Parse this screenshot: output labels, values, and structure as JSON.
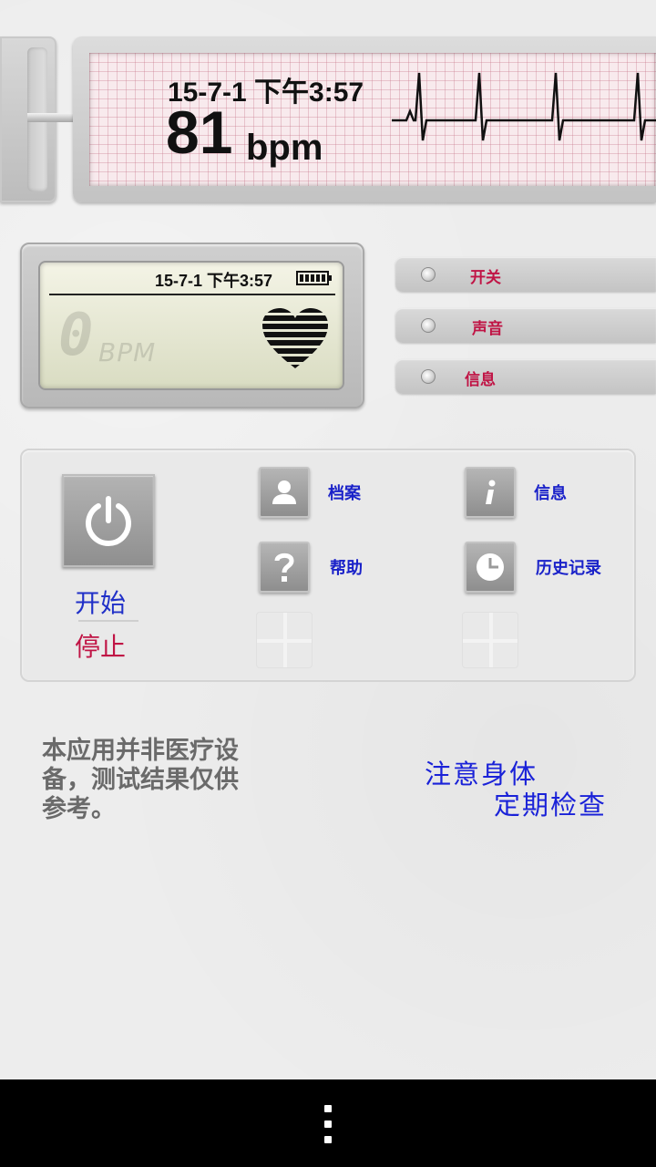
{
  "ecg_strip": {
    "date_time": "15-7-1 下午3:57",
    "bpm_value": "81",
    "bpm_unit": "bpm"
  },
  "lcd": {
    "date_time": "15-7-1 下午3:57",
    "bpm_digit": "0",
    "bpm_label": "BPM",
    "battery_level": 1.0
  },
  "toggles": [
    {
      "label": "开关"
    },
    {
      "label": "声音"
    },
    {
      "label": "信息"
    }
  ],
  "controls": {
    "start_label": "开始",
    "stop_label": "停止",
    "profile_label": "档案",
    "info_label": "信息",
    "help_label": "帮助",
    "history_label": "历史记录"
  },
  "disclaimer": "本应用并非医疗设备，测试结果仅供参考。",
  "health_tip": {
    "line1": "注意身体",
    "line2": "定期检查"
  },
  "colors": {
    "label_red": "#c01445",
    "label_blue": "#1a22c9"
  }
}
